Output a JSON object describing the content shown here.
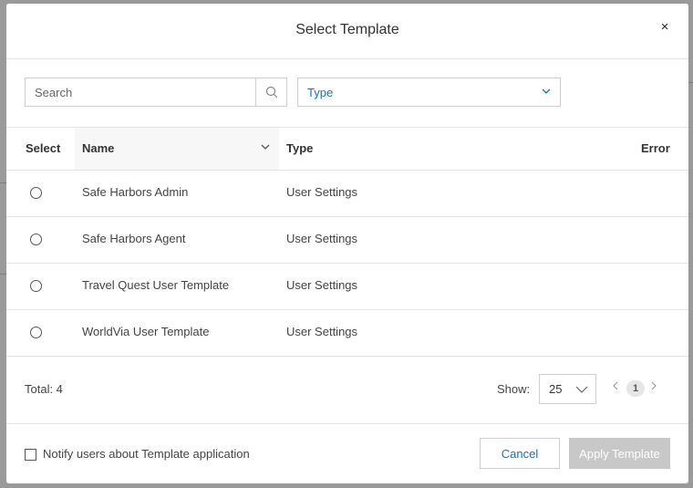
{
  "dialog": {
    "title": "Select Template",
    "close_symbol": "×"
  },
  "filters": {
    "search_placeholder": "Search",
    "search_icon": "search-icon",
    "type_label": "Type",
    "type_icon": "chevron-down-icon"
  },
  "table": {
    "columns": {
      "select": "Select",
      "name": "Name",
      "type": "Type",
      "error": "Error"
    },
    "rows": [
      {
        "name": "Safe Harbors Admin",
        "type": "User Settings",
        "error": ""
      },
      {
        "name": "Safe Harbors Agent",
        "type": "User Settings",
        "error": ""
      },
      {
        "name": "Travel Quest User Template",
        "type": "User Settings",
        "error": ""
      },
      {
        "name": "WorldVia User Template",
        "type": "User Settings",
        "error": ""
      }
    ]
  },
  "pagination": {
    "total_label": "Total: 4",
    "show_label": "Show:",
    "page_size": "25",
    "current_page": "1"
  },
  "actions": {
    "notify_label": "Notify users about Template application",
    "cancel_label": "Cancel",
    "apply_label": "Apply Template"
  },
  "colors": {
    "accent": "#1a73a8",
    "disabled_button": "#c8c8c8",
    "overlay": "#9a9a9a"
  }
}
